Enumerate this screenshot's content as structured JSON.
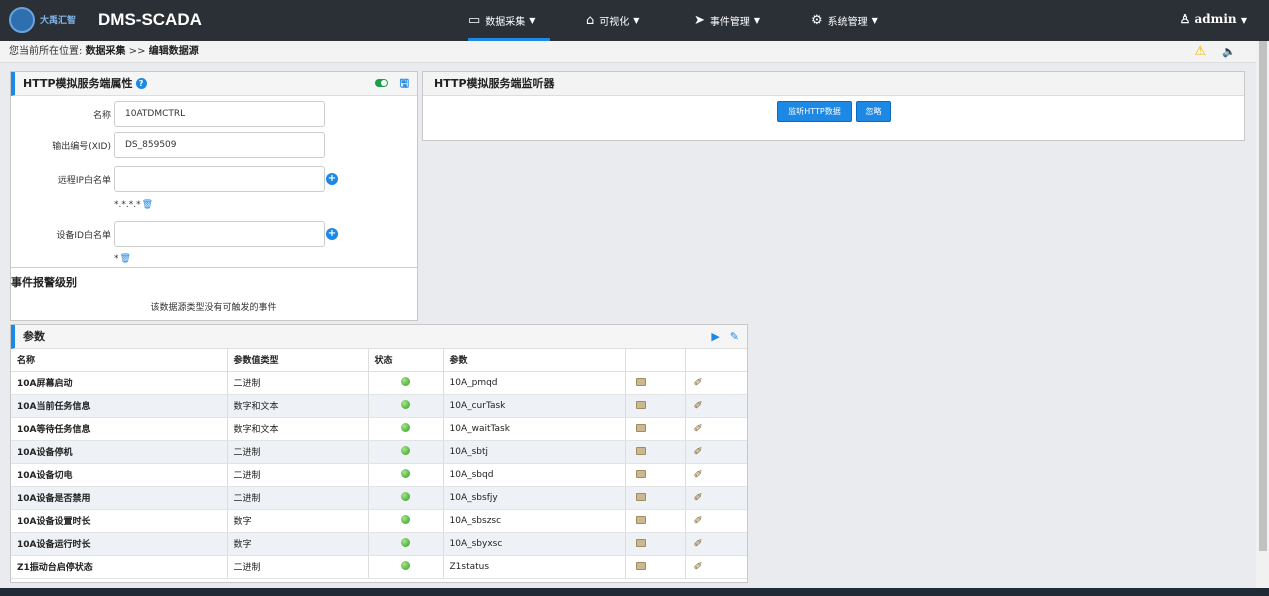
{
  "app": {
    "logo_text": "大禹汇智",
    "title": "DMS-SCADA"
  },
  "nav": [
    {
      "icon": "▭",
      "label": "数据采集",
      "active": true
    },
    {
      "icon": "⌂",
      "label": "可视化"
    },
    {
      "icon": "➤",
      "label": "事件管理"
    },
    {
      "icon": "⚙",
      "label": "系统管理"
    }
  ],
  "user": {
    "name": "admin"
  },
  "breadcrumb": {
    "prefix": "您当前所在位置:",
    "section": "数据采集",
    "separator": ">>",
    "page": "编辑数据源"
  },
  "props": {
    "title": "HTTP模拟服务端属性",
    "name_label": "名称",
    "name_value": "10ATDMCTRL",
    "xid_label": "输出编号(XID)",
    "xid_value": "DS_859509",
    "ip_label": "远程IP白名单",
    "ip_entry": "*.*.*.*",
    "device_label": "设备ID白名单",
    "device_entry": "*"
  },
  "events": {
    "title": "事件报警级别",
    "note": "该数据源类型没有可触发的事件"
  },
  "listener": {
    "title": "HTTP模拟服务端监听器",
    "listen_btn": "监听HTTP数据",
    "ignore_btn": "忽略"
  },
  "params": {
    "title": "参数",
    "columns": [
      "名称",
      "参数值类型",
      "状态",
      "参数"
    ],
    "rows": [
      {
        "name": "10A屏幕启动",
        "type": "二进制",
        "param": "10A_pmqd"
      },
      {
        "name": "10A当前任务信息",
        "type": "数字和文本",
        "param": "10A_curTask"
      },
      {
        "name": "10A等待任务信息",
        "type": "数字和文本",
        "param": "10A_waitTask"
      },
      {
        "name": "10A设备停机",
        "type": "二进制",
        "param": "10A_sbtj"
      },
      {
        "name": "10A设备切电",
        "type": "二进制",
        "param": "10A_sbqd"
      },
      {
        "name": "10A设备是否禁用",
        "type": "二进制",
        "param": "10A_sbsfjy"
      },
      {
        "name": "10A设备设置时长",
        "type": "数字",
        "param": "10A_sbszsc"
      },
      {
        "name": "10A设备运行时长",
        "type": "数字",
        "param": "10A_sbyxsc"
      },
      {
        "name": "Z1振动台启停状态",
        "type": "二进制",
        "param": "Z1status"
      }
    ]
  }
}
